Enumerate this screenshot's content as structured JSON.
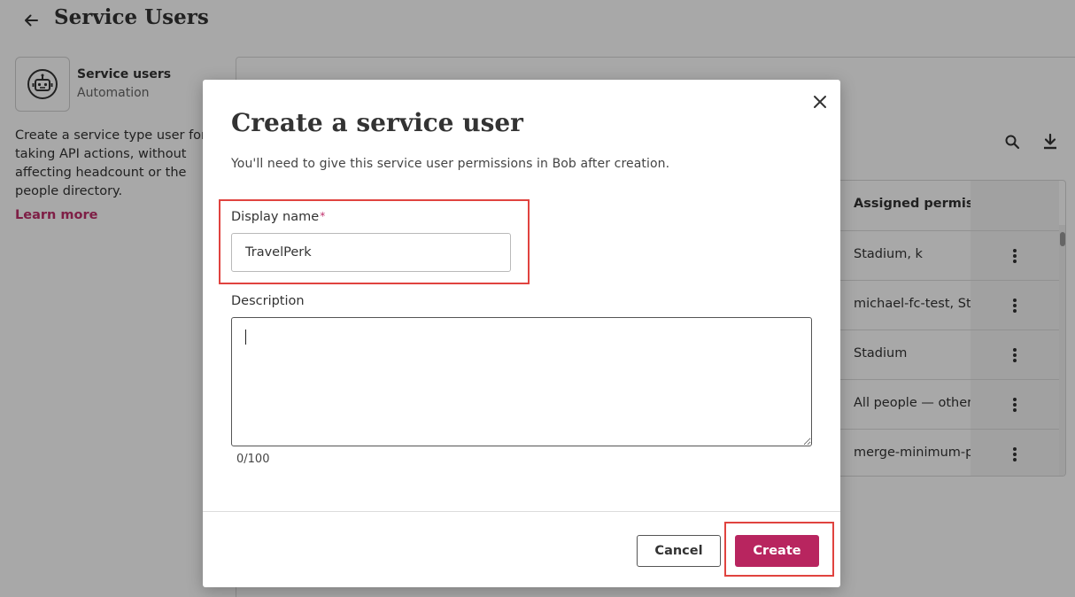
{
  "page": {
    "title": "Service Users",
    "app": {
      "name": "Service users",
      "category": "Automation",
      "description": "Create a service type user for taking API actions, without affecting headcount or the people directory.",
      "learn_more": "Learn more"
    },
    "icons": {
      "back": "arrow-left-icon",
      "app": "robot-icon",
      "search": "search-icon",
      "download": "download-icon"
    },
    "table": {
      "column_header": "Assigned permissions",
      "rows": [
        "Stadium, k",
        "michael-fc-test, Stadium",
        "Stadium",
        "All people — others",
        "merge-minimum-permissions"
      ]
    }
  },
  "modal": {
    "title": "Create a service user",
    "subtitle": "You'll need to give this service user permissions in Bob after creation.",
    "display_name": {
      "label": "Display name",
      "required_marker": "*",
      "value": "TravelPerk"
    },
    "description": {
      "label": "Description",
      "value": "",
      "counter": "0/100"
    },
    "cancel_label": "Cancel",
    "create_label": "Create"
  },
  "colors": {
    "accent": "#b8255f",
    "link": "#c0306b",
    "highlight": "#e0433f",
    "overlay": "rgba(0,0,0,0.34)"
  }
}
